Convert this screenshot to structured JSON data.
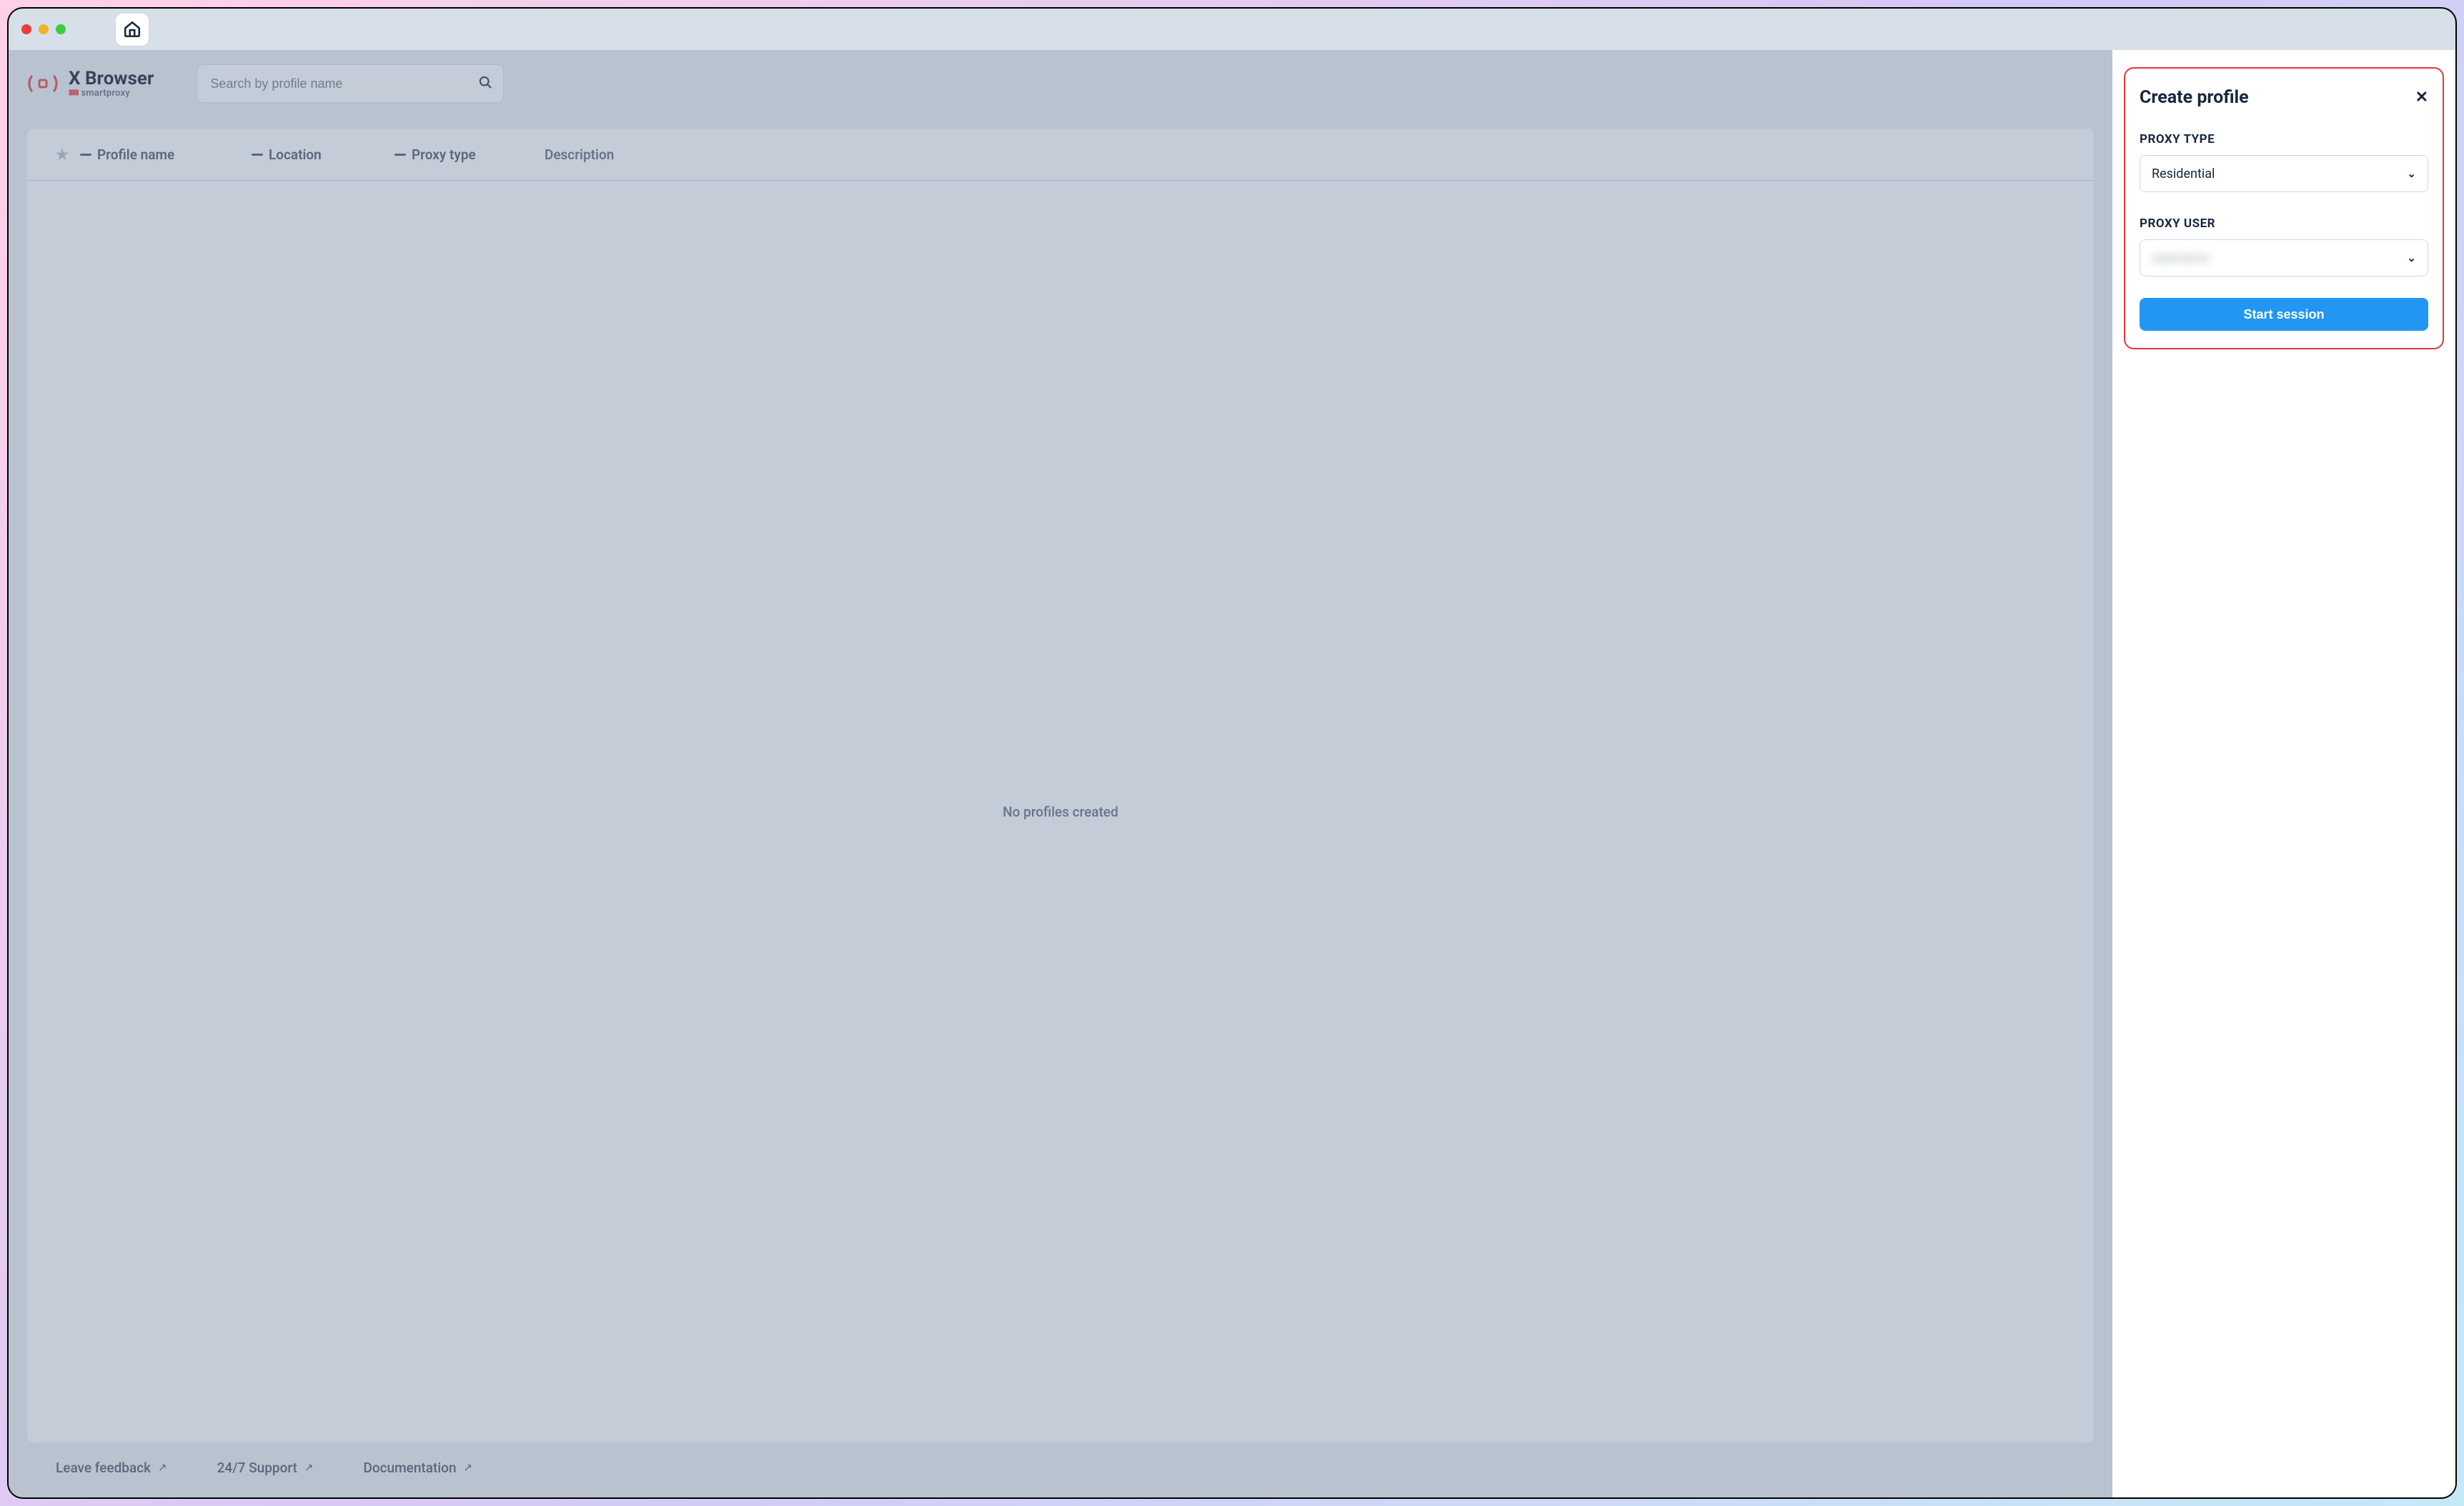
{
  "app": {
    "title": "X Browser",
    "subtitle": "smartproxy"
  },
  "search": {
    "placeholder": "Search by profile name"
  },
  "table": {
    "columns": {
      "profile": "Profile name",
      "location": "Location",
      "proxy": "Proxy type",
      "description": "Description"
    },
    "empty": "No profiles created"
  },
  "footer": {
    "feedback": "Leave feedback",
    "support": "24/7 Support",
    "docs": "Documentation"
  },
  "panel": {
    "title": "Create profile",
    "proxy_type_label": "PROXY TYPE",
    "proxy_type_value": "Residential",
    "proxy_user_label": "PROXY USER",
    "proxy_user_value": "username",
    "start_button": "Start session"
  }
}
